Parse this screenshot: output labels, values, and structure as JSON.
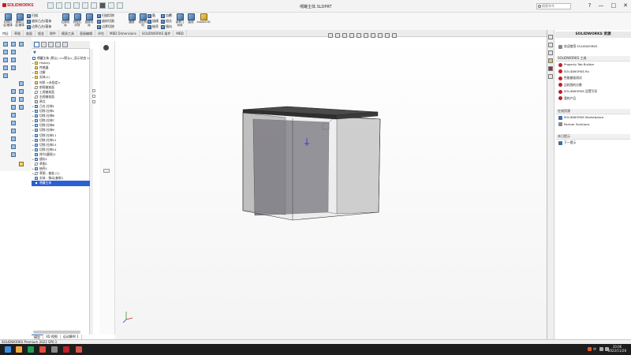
{
  "titlebar": {
    "app_logo": "SOLIDWORKS",
    "document_title": "喂罐主体.SLDPRT",
    "search_placeholder": "搜索命令",
    "window_controls": [
      "?",
      "—",
      "□",
      "✕"
    ]
  },
  "ribbon": {
    "buttons": [
      {
        "label": "拉伸凸\n台/基体",
        "icon": "extrude-boss-icon"
      },
      {
        "label": "旋转凸\n台/基体",
        "icon": "revolve-boss-icon"
      },
      {
        "label": "拉伸切\n除",
        "icon": "extrude-cut-icon"
      },
      {
        "label": "异型孔\n向导",
        "icon": "hole-wizard-icon"
      },
      {
        "label": "旋转切\n除",
        "icon": "revolve-cut-icon"
      },
      {
        "label": "圆角",
        "icon": "fillet-icon"
      },
      {
        "label": "线性阵\n列",
        "icon": "linear-pattern-icon"
      },
      {
        "label": "参考几\n何体",
        "icon": "reference-geometry-icon"
      },
      {
        "label": "曲线",
        "icon": "curves-icon"
      },
      {
        "label": "Instant3D",
        "icon": "instant3d-icon"
      }
    ],
    "small_rows": [
      {
        "label": "扫描",
        "icon": "sweep-icon"
      },
      {
        "label": "放样凸台/基体",
        "icon": "loft-icon"
      },
      {
        "label": "边界凸台/基体",
        "icon": "boundary-boss-icon"
      },
      {
        "label": "扫描切除",
        "icon": "swept-cut-icon"
      },
      {
        "label": "放样切割",
        "icon": "lofted-cut-icon"
      },
      {
        "label": "边界切除",
        "icon": "boundary-cut-icon"
      },
      {
        "label": "筋",
        "icon": "rib-icon"
      },
      {
        "label": "拔模",
        "icon": "draft-icon"
      },
      {
        "label": "抽壳",
        "icon": "shell-icon"
      },
      {
        "label": "包覆",
        "icon": "wrap-icon"
      },
      {
        "label": "相交",
        "icon": "intersect-icon"
      },
      {
        "label": "镜向",
        "icon": "mirror-icon"
      }
    ]
  },
  "command_tabs": [
    "特征",
    "草图",
    "曲面",
    "钣金",
    "焊件",
    "模具工具",
    "直接编辑",
    "评估",
    "MBD Dimensions",
    "SOLIDWORKS 插件",
    "MBD"
  ],
  "feature_tree": {
    "items": [
      {
        "label": "喂罐主体 (默认) <<默认>_显示状态 1>",
        "icon": "part",
        "arrow": ""
      },
      {
        "label": "History",
        "icon": "folder",
        "arrow": "▸"
      },
      {
        "label": "传感器",
        "icon": "folder",
        "arrow": ""
      },
      {
        "label": "注解",
        "icon": "folder",
        "arrow": "▸"
      },
      {
        "label": "实体(1)",
        "icon": "folder",
        "arrow": "▸"
      },
      {
        "label": "材质 <未指定>",
        "icon": "folder",
        "arrow": ""
      },
      {
        "label": "前视基准面",
        "icon": "plane",
        "arrow": ""
      },
      {
        "label": "上视基准面",
        "icon": "plane",
        "arrow": ""
      },
      {
        "label": "右视基准面",
        "icon": "plane",
        "arrow": ""
      },
      {
        "label": "原点",
        "icon": "origin",
        "arrow": ""
      },
      {
        "label": "凸台-拉伸1",
        "icon": "feat",
        "arrow": "▸"
      },
      {
        "label": "切除-拉伸1",
        "icon": "feat",
        "arrow": "▸"
      },
      {
        "label": "切除-拉伸6",
        "icon": "feat",
        "arrow": "▸"
      },
      {
        "label": "切除-拉伸7",
        "icon": "feat",
        "arrow": "▸"
      },
      {
        "label": "切除-拉伸8",
        "icon": "feat",
        "arrow": "▸"
      },
      {
        "label": "切除-拉伸9",
        "icon": "feat",
        "arrow": "▸"
      },
      {
        "label": "切除-拉伸11",
        "icon": "feat",
        "arrow": "▸"
      },
      {
        "label": "切除-拉伸12",
        "icon": "feat",
        "arrow": "▸"
      },
      {
        "label": "切除-拉伸13",
        "icon": "feat",
        "arrow": "▸"
      },
      {
        "label": "切除-拉伸14",
        "icon": "feat",
        "arrow": "▸"
      },
      {
        "label": "阵列(圆周)1",
        "icon": "feat",
        "arrow": ""
      },
      {
        "label": "镜向1",
        "icon": "feat",
        "arrow": "▸"
      },
      {
        "label": "草图1",
        "icon": "plane",
        "arrow": ""
      },
      {
        "label": "抽壳1",
        "icon": "feat",
        "arrow": "▸"
      },
      {
        "label": "草图 - 基准 (1)",
        "icon": "plane",
        "arrow": "▸"
      },
      {
        "label": "实体 - 移动/复制1",
        "icon": "feat",
        "arrow": ""
      },
      {
        "label": "喂罐主体",
        "icon": "part",
        "arrow": "",
        "selected": true
      }
    ]
  },
  "bottom_tabs": [
    "模型",
    "3D 视图",
    "运动算例 1"
  ],
  "task_pane": {
    "header": "SOLIDWORKS 资源",
    "top_link": "欢迎使用 SOLIDWORKS",
    "sections": [
      {
        "title": "SOLIDWORKS 工具",
        "items": [
          "Property Tab Builder",
          "SOLIDWORKS Rx",
          "性能基准测试",
          "比较我的分数",
          "SOLIDWORKS 设置引导",
          "我的产品"
        ]
      },
      {
        "title": "在线资源",
        "items": [
          "SOLIDWORKS Marketplace",
          "Partner Solutions"
        ]
      },
      {
        "title": "本日提示",
        "items": [
          "下一提示"
        ]
      }
    ]
  },
  "status_bar": {
    "text": "SOLIDWORKS Premium 2022 SP0.1"
  },
  "taskbar": {
    "clock_time": "10:06",
    "clock_date": "2022/11/28",
    "tray_text": "中"
  }
}
